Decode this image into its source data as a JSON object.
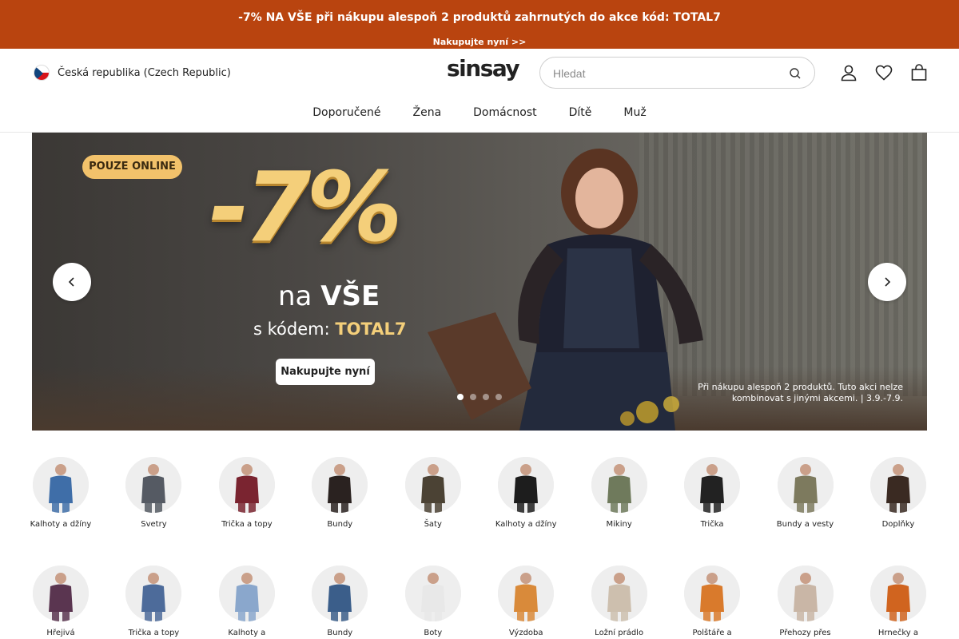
{
  "promo": {
    "glyph": "",
    "text_main": "-7% NA VŠE při nákupu alespoň 2 produktů zahrnutých do akce",
    "text_code": "kód: TOTAL7",
    "link": "Nakupujte nyní >>",
    "color": "#b9440f"
  },
  "header": {
    "country": "Česká republika (Czech Republic)",
    "logo": "sinsay",
    "search_placeholder": "Hledat",
    "icons": [
      "user-icon",
      "heart-icon",
      "cart-icon"
    ]
  },
  "nav": {
    "items": [
      "Doporučené",
      "Žena",
      "Domácnost",
      "Dítě",
      "Muž"
    ]
  },
  "hero": {
    "badge": "POUZE ONLINE",
    "discount": "-7%",
    "line_na": "na",
    "line_vse": "VŠE",
    "code_prefix": "s kódem:",
    "code": "TOTAL7",
    "button": "Nakupujte nyní",
    "fine_print_1": "Při nákupu alespoň 2 produktů. Tuto akci nelze",
    "fine_print_2": "kombinovat s jinými akcemi. | 3.9.-7.9.",
    "slide_count": 4,
    "active_slide": 1
  },
  "categories_row1": [
    {
      "label": "Kalhoty a džíny",
      "tone": "#3f6ea8"
    },
    {
      "label": "Svetry",
      "tone": "#555a63"
    },
    {
      "label": "Trička a topy",
      "tone": "#7a2430"
    },
    {
      "label": "Bundy",
      "tone": "#2a2220"
    },
    {
      "label": "Šaty",
      "tone": "#4b4234"
    },
    {
      "label": "Kalhoty a džíny",
      "tone": "#1d1d1d"
    },
    {
      "label": "Mikiny",
      "tone": "#6f7a5c"
    },
    {
      "label": "Trička",
      "tone": "#222222"
    },
    {
      "label": "Bundy a vesty",
      "tone": "#7d7a5e"
    },
    {
      "label": "Doplňky",
      "tone": "#3a2a22"
    }
  ],
  "categories_row2": [
    {
      "label": "Hřejivá",
      "tone": "#5a3550"
    },
    {
      "label": "Trička a topy",
      "tone": "#4d6b9a"
    },
    {
      "label": "Kalhoty a",
      "tone": "#8aa7cc"
    },
    {
      "label": "Bundy",
      "tone": "#3b5e8a"
    },
    {
      "label": "Boty",
      "tone": "#e8e8e8"
    },
    {
      "label": "Výzdoba",
      "tone": "#d98a3a"
    },
    {
      "label": "Ložní prádlo",
      "tone": "#cdbfae"
    },
    {
      "label": "Polštáře a",
      "tone": "#d97a2c"
    },
    {
      "label": "Přehozy přes",
      "tone": "#c9b6a6"
    },
    {
      "label": "Hrnečky a",
      "tone": "#d0641f"
    }
  ]
}
